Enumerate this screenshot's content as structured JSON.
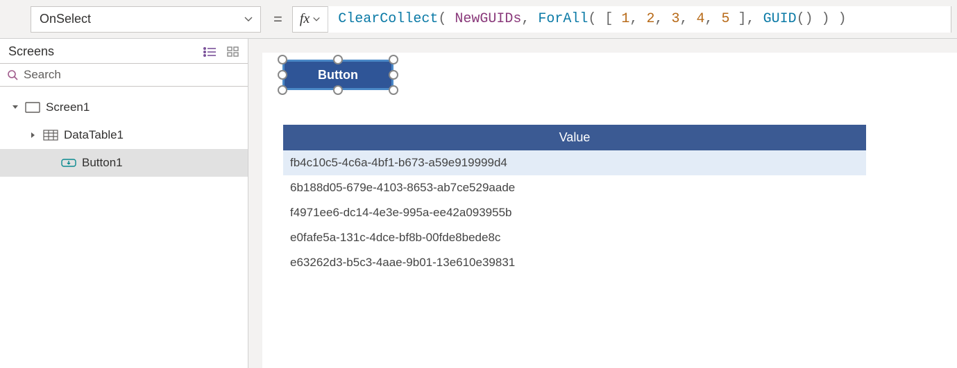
{
  "property": {
    "name": "OnSelect"
  },
  "formula": {
    "tokens": [
      {
        "t": "fn",
        "v": "ClearCollect"
      },
      {
        "t": "p",
        "v": "( "
      },
      {
        "t": "id",
        "v": "NewGUIDs"
      },
      {
        "t": "p",
        "v": ", "
      },
      {
        "t": "fn",
        "v": "ForAll"
      },
      {
        "t": "p",
        "v": "( [ "
      },
      {
        "t": "num",
        "v": "1"
      },
      {
        "t": "p",
        "v": ", "
      },
      {
        "t": "num",
        "v": "2"
      },
      {
        "t": "p",
        "v": ", "
      },
      {
        "t": "num",
        "v": "3"
      },
      {
        "t": "p",
        "v": ", "
      },
      {
        "t": "num",
        "v": "4"
      },
      {
        "t": "p",
        "v": ", "
      },
      {
        "t": "num",
        "v": "5"
      },
      {
        "t": "p",
        "v": " ], "
      },
      {
        "t": "fn",
        "v": "GUID"
      },
      {
        "t": "p",
        "v": "() ) )"
      }
    ]
  },
  "left": {
    "title": "Screens",
    "search_placeholder": "Search",
    "tree": {
      "screen_label": "Screen1",
      "datatable_label": "DataTable1",
      "button_label": "Button1"
    }
  },
  "canvas": {
    "button_text": "Button",
    "table": {
      "header": "Value",
      "rows": [
        "fb4c10c5-4c6a-4bf1-b673-a59e919999d4",
        "6b188d05-679e-4103-8653-ab7ce529aade",
        "f4971ee6-dc14-4e3e-995a-ee42a093955b",
        "e0fafe5a-131c-4dce-bf8b-00fde8bede8c",
        "e63262d3-b5c3-4aae-9b01-13e610e39831"
      ]
    }
  }
}
